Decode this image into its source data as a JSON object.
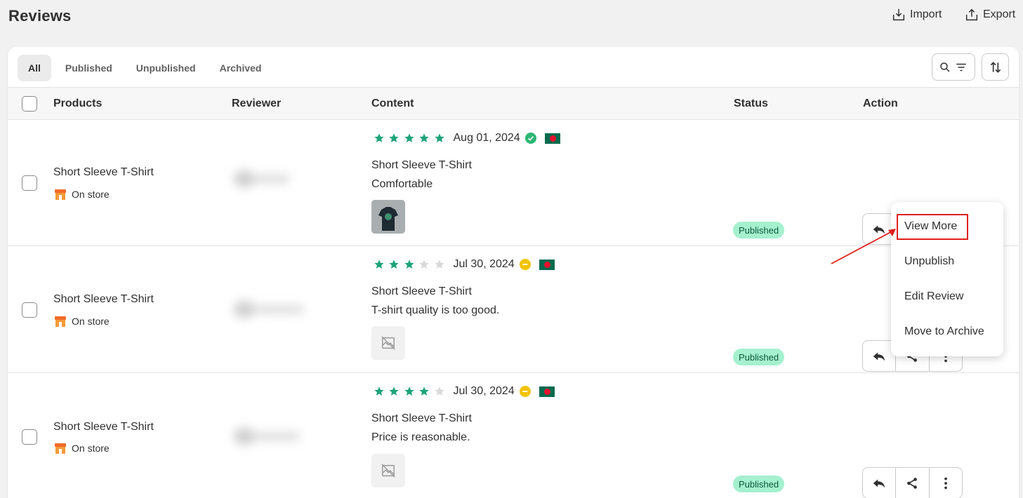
{
  "header": {
    "title": "Reviews",
    "import_label": "Import",
    "export_label": "Export"
  },
  "tabs": [
    {
      "label": "All",
      "active": true
    },
    {
      "label": "Published",
      "active": false
    },
    {
      "label": "Unpublished",
      "active": false
    },
    {
      "label": "Archived",
      "active": false
    }
  ],
  "table": {
    "columns": [
      "Products",
      "Reviewer",
      "Content",
      "Status",
      "Action"
    ]
  },
  "rows": [
    {
      "product": "Short Sleeve T-Shirt",
      "store": "On store",
      "rating": 5,
      "date": "Aug 01, 2024",
      "verify_icon": "check-circle-icon",
      "flag_icon": "bangladesh-flag-icon",
      "content_title": "Short Sleeve T-Shirt",
      "content_text": "Comfortable",
      "media": "tshirt-photo",
      "status": "Published"
    },
    {
      "product": "Short Sleeve T-Shirt",
      "store": "On store",
      "rating": 3,
      "date": "Jul 30, 2024",
      "verify_icon": "minus-circle-icon",
      "flag_icon": "bangladesh-flag-icon",
      "content_title": "Short Sleeve T-Shirt",
      "content_text": "T-shirt quality is too good.",
      "media": "image-placeholder",
      "status": "Published"
    },
    {
      "product": "Short Sleeve T-Shirt",
      "store": "On store",
      "rating": 4,
      "date": "Jul 30, 2024",
      "verify_icon": "minus-circle-icon",
      "flag_icon": "bangladesh-flag-icon",
      "content_title": "Short Sleeve T-Shirt",
      "content_text": "Price is reasonable.",
      "media": "image-placeholder",
      "status": "Published"
    }
  ],
  "dropdown_menu": {
    "items": [
      "View More",
      "Unpublish",
      "Edit Review",
      "Move to Archive"
    ],
    "highlighted": "View More"
  },
  "colors": {
    "star_filled": "#1fa37a",
    "star_empty": "#d9d9d9",
    "status_bg": "#a5f0cf",
    "annotation_red": "#e0201b",
    "verified_green": "#2bb673",
    "pending_yellow": "#f2c300"
  }
}
